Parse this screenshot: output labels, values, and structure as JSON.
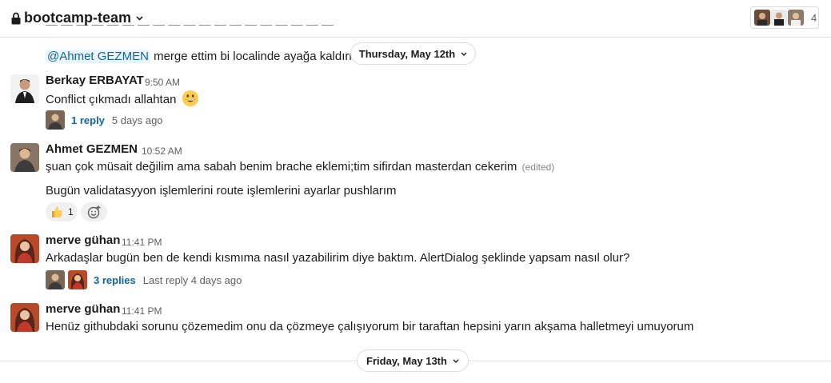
{
  "header": {
    "channel_name": "bootcamp-team",
    "member_count": "4"
  },
  "date_dividers": {
    "top": "Thursday, May 12th",
    "bottom": "Friday, May 13th"
  },
  "partial_message": {
    "mention": "@Ahmet GEZMEN",
    "text": " merge ettim bi localinde ayağa kaldırm"
  },
  "messages": [
    {
      "sender": "Berkay ERBAYAT",
      "time": "9:50 AM",
      "text": "Conflict çıkmadı allahtan",
      "emoji": "grinning-face",
      "thread": {
        "replies": "1 reply",
        "last": "5 days ago"
      }
    },
    {
      "sender": "Ahmet GEZMEN",
      "time": "10:52 AM",
      "text": "şuan çok müsait değilim ama sabah benim brache eklemi;tim sifirdan masterdan cekerim",
      "edited": "(edited)",
      "text2": "Bugün validatasyyon işlemlerini route işlemlerini ayarlar pushlarım",
      "reaction": {
        "emoji": "thumbs-up",
        "count": "1"
      }
    },
    {
      "sender": "merve gühan",
      "time": "11:41 PM",
      "text": "Arkadaşlar bugün ben de kendi kısmıma nasıl yazabilirim diye baktım. AlertDialog şeklinde yapsam nasıl olur?",
      "thread": {
        "replies": "3 replies",
        "last": "Last reply 4 days ago"
      }
    },
    {
      "sender": "merve gühan",
      "time": "11:41 PM",
      "text": "Henüz githubdaki sorunu çözemedim onu da çözmeye çalışıyorum bir taraftan hepsini yarın akşama halletmeyi umuyorum"
    }
  ],
  "colors": {
    "link": "#1264a3",
    "mention_bg": "#e8f5fa",
    "muted": "#616061",
    "divider": "#e2e2e2"
  }
}
